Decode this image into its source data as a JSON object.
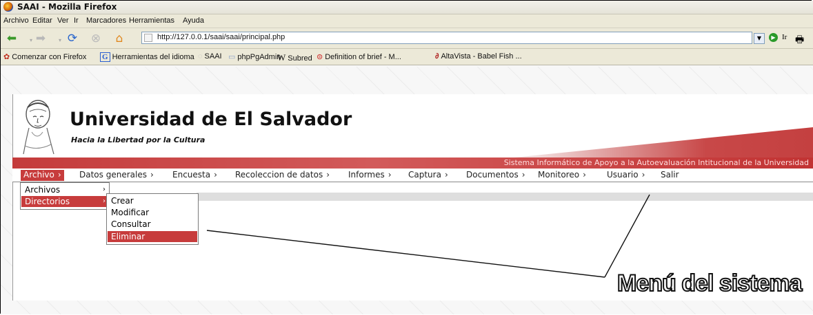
{
  "window": {
    "title": "SAAI - Mozilla Firefox"
  },
  "browser_menu": [
    "Archivo",
    "Editar",
    "Ver",
    "Ir",
    "Marcadores",
    "Herramientas",
    "Ayuda"
  ],
  "navigation": {
    "url": "http://127.0.0.1/saai/saai/principal.php",
    "go_label": "Ir"
  },
  "bookmarks": [
    "Comenzar con Firefox",
    "Herramientas del idioma",
    "SAAI",
    "phpPgAdmin",
    "Subred",
    "Definition of brief - M...",
    "AltaVista - Babel Fish ..."
  ],
  "site": {
    "name": "Universidad de El Salvador",
    "motto": "Hacia la Libertad por la Cultura",
    "system_name": "Sistema Informático de Apoyo a la Autoevaluación Intitucional de la Universidad"
  },
  "main_menu": [
    {
      "label": "Archivo",
      "arrow": "›"
    },
    {
      "label": "Datos generales",
      "arrow": "›"
    },
    {
      "label": "Encuesta",
      "arrow": "›"
    },
    {
      "label": "Recoleccion de datos",
      "arrow": "›"
    },
    {
      "label": "Informes",
      "arrow": "›"
    },
    {
      "label": "Captura",
      "arrow": "›"
    },
    {
      "label": "Documentos",
      "arrow": "›"
    },
    {
      "label": "Monitoreo",
      "arrow": "›"
    },
    {
      "label": "Usuario",
      "arrow": "›"
    },
    {
      "label": "Salir",
      "arrow": ""
    }
  ],
  "archivo_submenu": [
    {
      "label": "Archivos",
      "arrow": "›"
    },
    {
      "label": "Directorios",
      "arrow": "›"
    }
  ],
  "directorios_submenu": [
    "Crear",
    "Modificar",
    "Consultar",
    "Eliminar"
  ],
  "annotation": "Menú del sistema",
  "colors": {
    "accent_red": "#c73c3c",
    "window_chrome": "#ece9d8"
  }
}
